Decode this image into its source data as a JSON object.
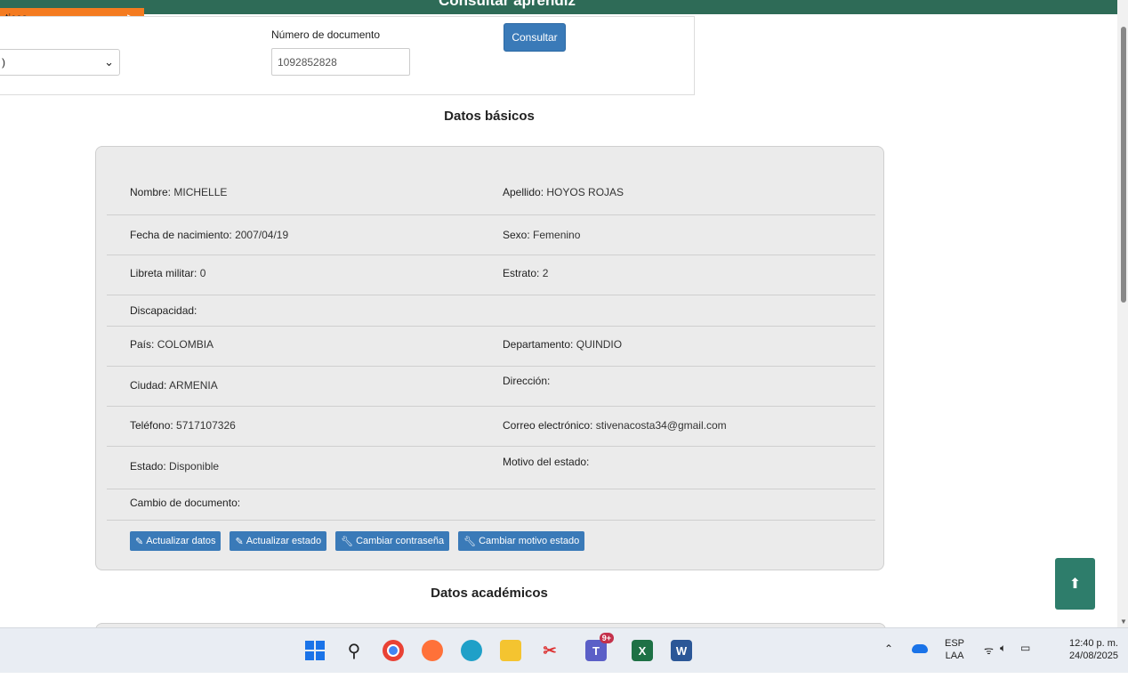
{
  "header": {
    "title": "Consultar aprendiz",
    "menu_label": "ticos"
  },
  "search": {
    "select_value": ")",
    "doc_label": "Número de documento",
    "doc_value": "1092852828",
    "consult_label": "Consultar"
  },
  "sections": {
    "basic": "Datos básicos",
    "academic": "Datos académicos"
  },
  "fields": {
    "nombre": {
      "label": "Nombre:",
      "value": "MICHELLE"
    },
    "apellido": {
      "label": "Apellido:",
      "value": "HOYOS ROJAS"
    },
    "fecha": {
      "label": "Fecha de nacimiento:",
      "value": "2007/04/19"
    },
    "sexo": {
      "label": "Sexo:",
      "value": "Femenino"
    },
    "libreta": {
      "label": "Libreta militar:",
      "value": "0"
    },
    "estrato": {
      "label": "Estrato:",
      "value": "2"
    },
    "discapacidad": {
      "label": "Discapacidad:",
      "value": ""
    },
    "pais": {
      "label": "País:",
      "value": "COLOMBIA"
    },
    "departamento": {
      "label": "Departamento:",
      "value": "QUINDIO"
    },
    "ciudad": {
      "label": "Ciudad:",
      "value": "ARMENIA"
    },
    "direccion": {
      "label": "Dirección:",
      "value": ""
    },
    "telefono": {
      "label": "Teléfono:",
      "value": "5717107326"
    },
    "correo": {
      "label": "Correo electrónico:",
      "value": "stivenacosta34@gmail.com"
    },
    "estado": {
      "label": "Estado:",
      "value": "Disponible"
    },
    "motivo": {
      "label": "Motivo del estado:",
      "value": ""
    },
    "cambio": {
      "label": "Cambio de documento:",
      "value": ""
    }
  },
  "actions": {
    "update_data": "Actualizar datos",
    "update_state": "Actualizar estado",
    "change_password": "Cambiar contraseña",
    "change_reason": "Cambiar motivo estado"
  },
  "taskbar": {
    "lang": "ESP",
    "lang_sub": "LAA",
    "time": "12:40 p. m.",
    "date": "24/08/2025",
    "teams_badge": "9+"
  },
  "colors": {
    "header": "#2e6b57",
    "menu": "#f47b20",
    "primary": "#3a7ab8",
    "scroll_top": "#2e7d6b"
  }
}
